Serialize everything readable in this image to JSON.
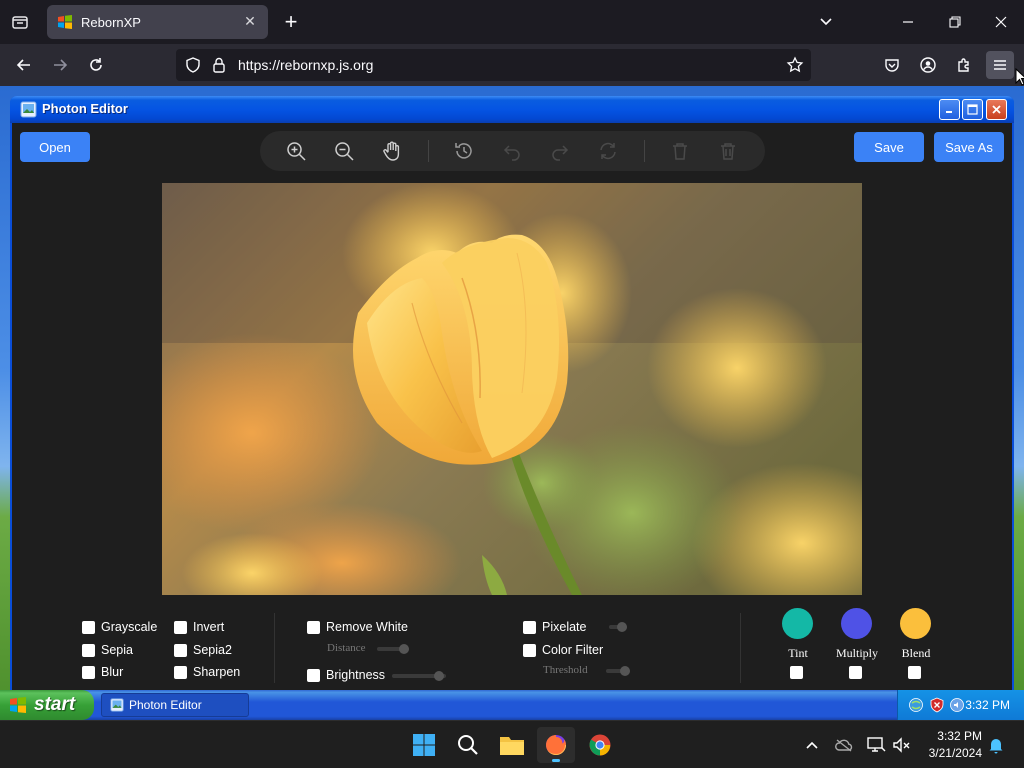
{
  "browser": {
    "tab_title": "RebornXP",
    "url": "https://rebornxp.js.org"
  },
  "window": {
    "title": "Photon Editor"
  },
  "editor": {
    "open_label": "Open",
    "save_label": "Save",
    "save_as_label": "Save As",
    "filters": {
      "grayscale": "Grayscale",
      "sepia": "Sepia",
      "blur": "Blur",
      "invert": "Invert",
      "sepia2": "Sepia2",
      "sharpen": "Sharpen",
      "remove_white": "Remove White",
      "distance": "Distance",
      "brightness": "Brightness",
      "pixelate": "Pixelate",
      "color_filter": "Color Filter",
      "threshold": "Threshold"
    },
    "blend_modes": [
      {
        "label": "Tint",
        "color": "#14b8a6"
      },
      {
        "label": "Multiply",
        "color": "#4f52e6"
      },
      {
        "label": "Blend",
        "color": "#fbbf3c"
      }
    ]
  },
  "xp_taskbar": {
    "start_label": "start",
    "task_label": "Photon Editor",
    "tray_time": "3:32 PM"
  },
  "win11_taskbar": {
    "time": "3:32 PM",
    "date": "3/21/2024"
  },
  "colors": {
    "accent": "#3b82f6",
    "browser_bg": "#1c1b22",
    "app_bg": "#1e1e1e"
  }
}
